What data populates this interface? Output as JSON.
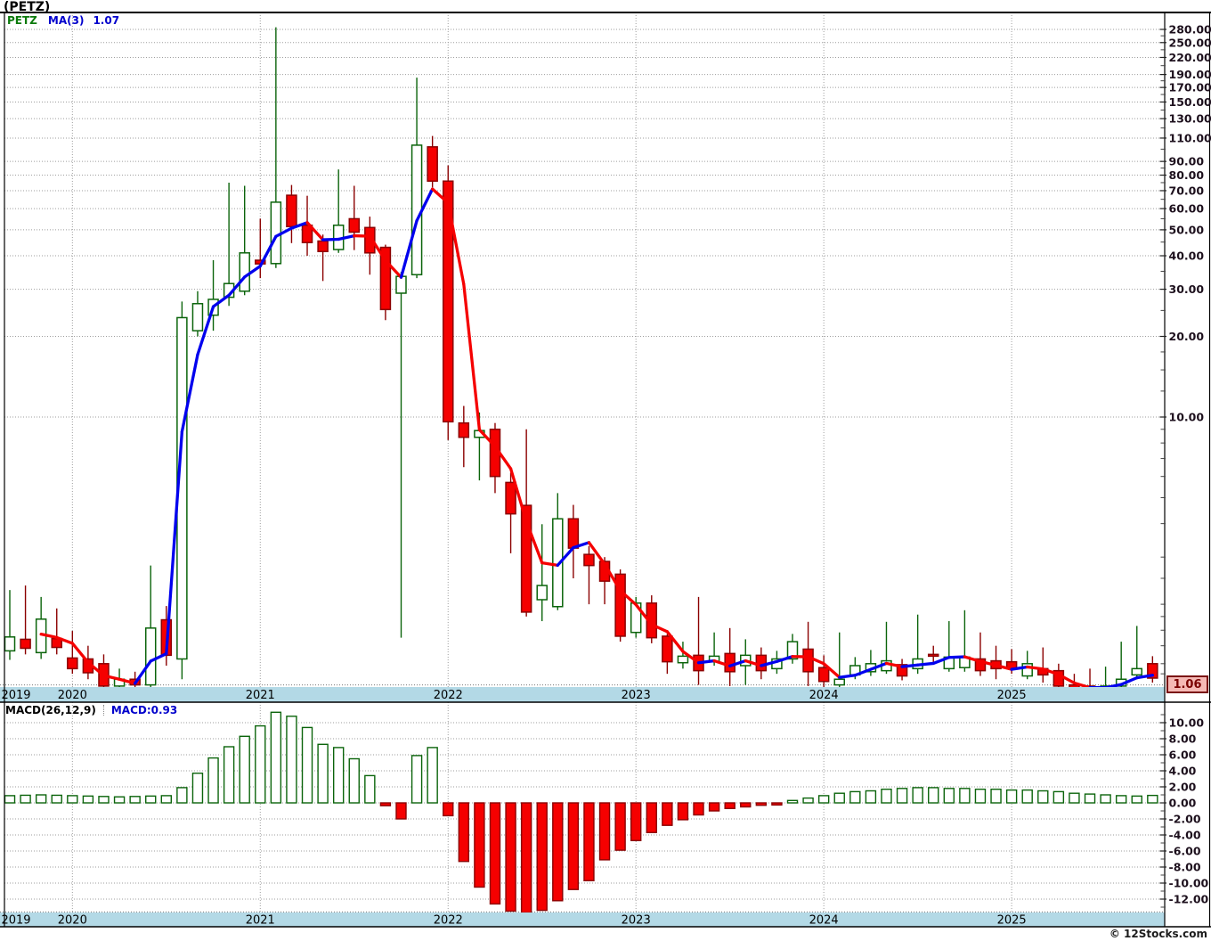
{
  "app": {
    "title": "(PETZ)",
    "copyright": "© 12Stocks.com"
  },
  "main_panel": {
    "legend": {
      "symbol": "PETZ",
      "ma_label": "MA(3)",
      "ma_value": "1.07"
    },
    "last_price": "1.06",
    "y_axis": {
      "labels": [
        "280.00",
        "250.00",
        "220.00",
        "190.00",
        "170.00",
        "150.00",
        "130.00",
        "110.00",
        "90.00",
        "80.00",
        "70.00",
        "60.00",
        "50.00",
        "40.00",
        "30.00",
        "20.00",
        "10.00"
      ]
    },
    "x_axis": {
      "years": [
        "2019",
        "2020",
        "2021",
        "2022",
        "2023",
        "2024",
        "2025"
      ]
    }
  },
  "macd_panel": {
    "legend": {
      "label": "MACD(26,12,9)",
      "value": "MACD:0.93"
    },
    "y_axis": {
      "labels": [
        "10.00",
        "8.00",
        "6.00",
        "4.00",
        "2.00",
        "0.00",
        "-2.00",
        "-4.00",
        "-6.00",
        "-8.00",
        "-10.00",
        "-12.00"
      ]
    },
    "x_axis": {
      "years": [
        "2019",
        "2020",
        "2021",
        "2022",
        "2023",
        "2024",
        "2025"
      ]
    }
  },
  "colors": {
    "up_candle_stroke": "#0b640b",
    "up_candle_fill": "#ffffff",
    "down_candle_fill": "#f50000",
    "down_candle_stroke": "#8b0000",
    "ma_up": "#0000ee",
    "ma_down": "#f50000",
    "axis_band": "#b3d9e6",
    "grid": "#9e9e9e",
    "axis_text": "#1d101d",
    "legend_symbol": "#0b7a0b",
    "legend_value": "#0000cc",
    "last_price_bg": "#f5b9b5",
    "last_price_text": "#7a0000"
  },
  "chart_data": [
    {
      "type": "candlestick",
      "title": "PETZ monthly price with MA(3) overlay",
      "y_scale": "log",
      "ylim": [
        0.99,
        300
      ],
      "x_range_months": [
        "2019-09",
        "2025-10"
      ],
      "ma_window": 3,
      "ma_last_value": 1.07,
      "last_close": 1.06,
      "columns": [
        "month",
        "open",
        "high",
        "low",
        "close"
      ],
      "candles": [
        [
          "2019-09",
          1.34,
          2.26,
          1.24,
          1.51
        ],
        [
          "2019-10",
          1.48,
          2.35,
          1.3,
          1.37
        ],
        [
          "2019-11",
          1.32,
          2.13,
          1.25,
          1.76
        ],
        [
          "2019-12",
          1.49,
          1.93,
          1.3,
          1.38
        ],
        [
          "2020-01",
          1.26,
          1.59,
          1.1,
          1.15
        ],
        [
          "2020-02",
          1.25,
          1.4,
          1.05,
          1.11
        ],
        [
          "2020-03",
          1.2,
          1.3,
          0.95,
          0.99
        ],
        [
          "2020-04",
          0.99,
          1.15,
          0.92,
          1.05
        ],
        [
          "2020-05",
          1.05,
          1.12,
          0.96,
          1.0
        ],
        [
          "2020-06",
          1.0,
          2.79,
          0.97,
          1.63
        ],
        [
          "2020-07",
          1.75,
          1.97,
          1.18,
          1.29
        ],
        [
          "2020-08",
          1.25,
          27.0,
          1.05,
          23.5
        ],
        [
          "2020-09",
          21.0,
          29.5,
          20.0,
          26.5
        ],
        [
          "2020-10",
          24.0,
          38.5,
          21.0,
          27.5
        ],
        [
          "2020-11",
          28.0,
          75.0,
          26.0,
          31.5
        ],
        [
          "2020-12",
          29.5,
          73.0,
          28.5,
          41.0
        ],
        [
          "2021-01",
          38.5,
          55.0,
          33.0,
          37.3
        ],
        [
          "2021-02",
          37.4,
          285.0,
          36.0,
          63.4
        ],
        [
          "2021-03",
          67.3,
          73.5,
          44.6,
          51.4
        ],
        [
          "2021-04",
          52.0,
          67.0,
          40.0,
          44.8
        ],
        [
          "2021-05",
          45.4,
          48.0,
          32.2,
          41.5
        ],
        [
          "2021-06",
          42.2,
          84.0,
          41.0,
          52.0
        ],
        [
          "2021-07",
          55.0,
          73.0,
          42.0,
          49.0
        ],
        [
          "2021-08",
          51.0,
          56.0,
          34.0,
          41.0
        ],
        [
          "2021-09",
          43.0,
          44.0,
          23.0,
          25.2
        ],
        [
          "2021-10",
          29.0,
          34.8,
          1.5,
          33.5
        ],
        [
          "2021-11",
          34.0,
          185.0,
          33.0,
          103.5
        ],
        [
          "2021-12",
          102.0,
          112.0,
          72.0,
          76.0
        ],
        [
          "2022-01",
          76.0,
          87.0,
          8.2,
          9.6
        ],
        [
          "2022-02",
          9.5,
          11.0,
          6.5,
          8.4
        ],
        [
          "2022-03",
          8.4,
          10.4,
          5.8,
          8.9
        ],
        [
          "2022-04",
          9.0,
          9.5,
          5.2,
          6.0
        ],
        [
          "2022-05",
          5.7,
          6.2,
          3.1,
          4.35
        ],
        [
          "2022-06",
          4.68,
          9.0,
          1.8,
          1.87
        ],
        [
          "2022-07",
          2.08,
          3.98,
          1.73,
          2.35
        ],
        [
          "2022-08",
          1.96,
          5.2,
          1.9,
          4.17
        ],
        [
          "2022-09",
          4.17,
          4.7,
          2.5,
          3.24
        ],
        [
          "2022-10",
          3.07,
          3.3,
          2.0,
          2.79
        ],
        [
          "2022-11",
          2.89,
          3.0,
          2.0,
          2.44
        ],
        [
          "2022-12",
          2.59,
          2.7,
          1.45,
          1.52
        ],
        [
          "2023-01",
          1.57,
          2.13,
          1.5,
          2.02
        ],
        [
          "2023-02",
          2.02,
          2.16,
          1.43,
          1.5
        ],
        [
          "2023-03",
          1.52,
          1.55,
          1.1,
          1.22
        ],
        [
          "2023-04",
          1.21,
          1.45,
          1.15,
          1.28
        ],
        [
          "2023-05",
          1.29,
          2.13,
          1.0,
          1.13
        ],
        [
          "2023-06",
          1.22,
          1.57,
          1.18,
          1.28
        ],
        [
          "2023-07",
          1.31,
          1.63,
          0.99,
          1.12
        ],
        [
          "2023-08",
          1.18,
          1.48,
          1.0,
          1.29
        ],
        [
          "2023-09",
          1.29,
          1.38,
          1.05,
          1.13
        ],
        [
          "2023-10",
          1.15,
          1.34,
          1.1,
          1.25
        ],
        [
          "2023-11",
          1.25,
          1.55,
          1.2,
          1.45
        ],
        [
          "2023-12",
          1.36,
          1.72,
          0.99,
          1.12
        ],
        [
          "2024-01",
          1.16,
          1.29,
          0.98,
          1.03
        ],
        [
          "2024-02",
          1.0,
          1.57,
          0.97,
          1.05
        ],
        [
          "2024-03",
          1.09,
          1.27,
          1.05,
          1.18
        ],
        [
          "2024-04",
          1.12,
          1.35,
          1.08,
          1.2
        ],
        [
          "2024-05",
          1.13,
          1.72,
          1.1,
          1.23
        ],
        [
          "2024-06",
          1.19,
          1.25,
          1.04,
          1.08
        ],
        [
          "2024-07",
          1.15,
          1.83,
          1.1,
          1.25
        ],
        [
          "2024-08",
          1.3,
          1.4,
          1.2,
          1.28
        ],
        [
          "2024-09",
          1.15,
          1.73,
          1.12,
          1.27
        ],
        [
          "2024-10",
          1.16,
          1.9,
          1.12,
          1.27
        ],
        [
          "2024-11",
          1.25,
          1.57,
          1.08,
          1.13
        ],
        [
          "2024-12",
          1.23,
          1.4,
          1.05,
          1.15
        ],
        [
          "2025-01",
          1.22,
          1.36,
          1.1,
          1.15
        ],
        [
          "2025-02",
          1.08,
          1.34,
          1.05,
          1.2
        ],
        [
          "2025-03",
          1.15,
          1.38,
          1.02,
          1.09
        ],
        [
          "2025-04",
          1.13,
          1.2,
          0.95,
          0.99
        ],
        [
          "2025-05",
          1.0,
          1.1,
          0.92,
          0.97
        ],
        [
          "2025-06",
          0.99,
          1.15,
          0.9,
          0.97
        ],
        [
          "2025-07",
          0.96,
          1.17,
          0.93,
          0.99
        ],
        [
          "2025-08",
          0.99,
          1.45,
          0.96,
          1.05
        ],
        [
          "2025-09",
          1.09,
          1.66,
          1.05,
          1.15
        ],
        [
          "2025-10",
          1.2,
          1.28,
          1.02,
          1.06
        ]
      ]
    },
    {
      "type": "bar",
      "title": "MACD(26,12,9)",
      "ylim": [
        -13.7,
        12.5
      ],
      "x": "same months as candlestick panel",
      "last_value": 0.93,
      "values": [
        0.9,
        0.95,
        1.0,
        0.95,
        0.9,
        0.85,
        0.8,
        0.75,
        0.8,
        0.85,
        0.9,
        1.9,
        3.7,
        5.6,
        7.0,
        8.3,
        9.6,
        11.3,
        10.8,
        9.4,
        7.3,
        6.9,
        5.5,
        3.4,
        -0.35,
        -2.0,
        5.9,
        6.9,
        -1.6,
        -7.3,
        -10.5,
        -12.6,
        -13.5,
        -13.7,
        -13.4,
        -12.2,
        -10.8,
        -9.7,
        -7.1,
        -5.9,
        -4.7,
        -3.7,
        -2.8,
        -2.1,
        -1.5,
        -1.0,
        -0.7,
        -0.5,
        -0.3,
        -0.26,
        0.3,
        0.6,
        0.9,
        1.2,
        1.4,
        1.5,
        1.7,
        1.8,
        1.9,
        1.9,
        1.8,
        1.8,
        1.7,
        1.7,
        1.6,
        1.6,
        1.5,
        1.4,
        1.2,
        1.1,
        1.0,
        0.9,
        0.85,
        0.93
      ]
    }
  ]
}
